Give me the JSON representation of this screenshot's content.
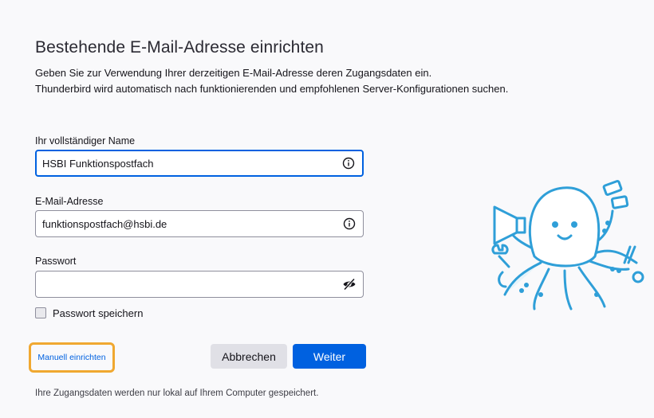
{
  "header": {
    "title": "Bestehende E-Mail-Adresse einrichten",
    "description_line1": "Geben Sie zur Verwendung Ihrer derzeitigen E-Mail-Adresse deren Zugangsdaten ein.",
    "description_line2": "Thunderbird wird automatisch nach funktionierenden und empfohlenen Server-Konfigurationen suchen."
  },
  "form": {
    "name": {
      "label": "Ihr vollständiger Name",
      "value": "HSBI Funktionspostfach",
      "icon": "info-icon"
    },
    "email": {
      "label": "E-Mail-Adresse",
      "value": "funktionspostfach@hsbi.de",
      "icon": "info-icon"
    },
    "password": {
      "label": "Passwort",
      "value": "",
      "icon": "eye-slash-icon"
    },
    "remember": {
      "label": "Passwort speichern",
      "checked": false
    }
  },
  "actions": {
    "manual_label": "Manuell einrichten",
    "cancel_label": "Abbrechen",
    "next_label": "Weiter"
  },
  "footer": {
    "note": "Ihre Zugangsdaten werden nur lokal auf Ihrem Computer gespeichert."
  },
  "colors": {
    "accent": "#0061e0",
    "highlight": "#f0a830",
    "mascot": "#2f9fd8"
  }
}
